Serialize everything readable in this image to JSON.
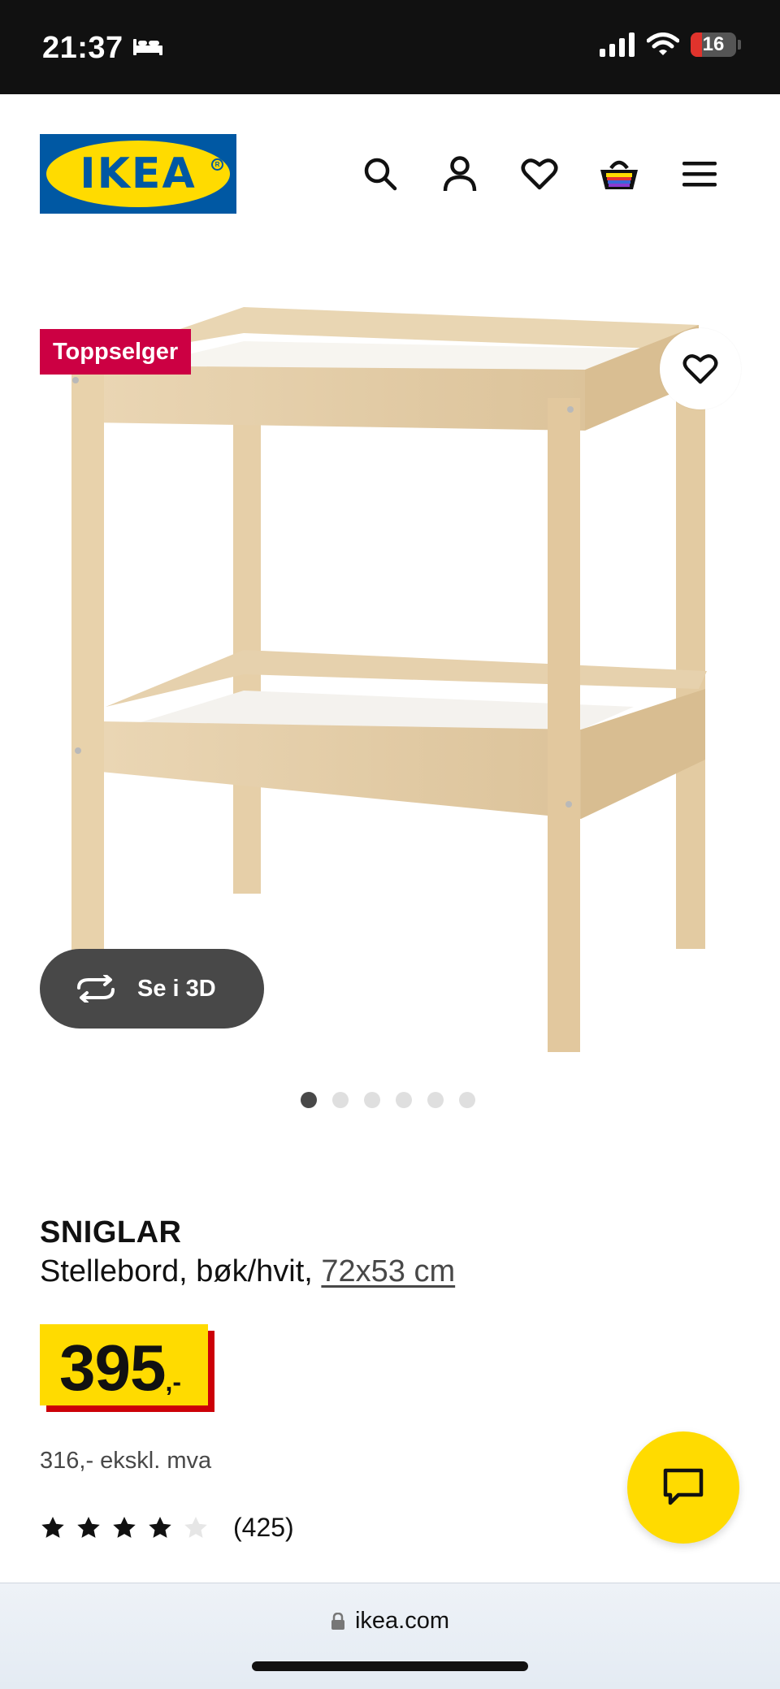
{
  "status_bar": {
    "time": "21:37",
    "battery": "16"
  },
  "header": {
    "logo_text": "IKEA",
    "icons": [
      "search-icon",
      "account-icon",
      "heart-icon",
      "basket-icon",
      "menu-icon"
    ]
  },
  "gallery": {
    "badge": "Toppselger",
    "view_3d_label": "Se i 3D",
    "image_count": 6,
    "active_index": 0
  },
  "product": {
    "name": "SNIGLAR",
    "description": "Stellebord, bøk/hvit,",
    "dimensions": "72x53 cm",
    "price_integer": "395",
    "price_decimal": ",-",
    "price_ex_vat": "316,- ekskl. mva",
    "rating": 4,
    "rating_max": 5,
    "review_count": "(425)"
  },
  "browser": {
    "domain": "ikea.com"
  },
  "colors": {
    "ikea_blue": "#0058a3",
    "ikea_yellow": "#ffdb00",
    "badge_red": "#cc0043",
    "price_shadow_red": "#cc0008"
  }
}
